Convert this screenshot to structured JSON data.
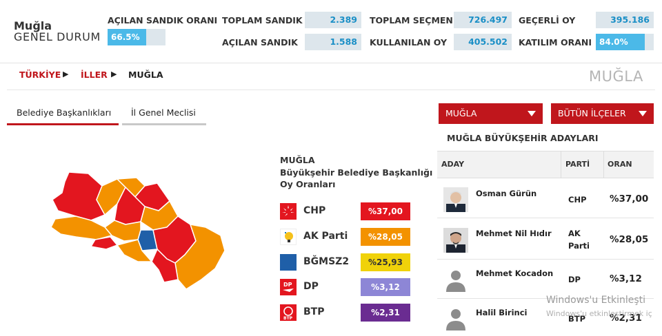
{
  "header": {
    "title_line1": "Muğla",
    "title_line2": "GENEL DURUM",
    "opened_ratio_label": "AÇILAN SANDIK ORANI",
    "opened_ratio_value": "66.5%",
    "opened_ratio_fraction": 0.665,
    "total_box_label": "TOPLAM SANDIK",
    "total_box_value": "2.389",
    "opened_box_label": "AÇILAN SANDIK",
    "opened_box_value": "1.588",
    "total_voters_label": "TOPLAM SEÇMEN",
    "total_voters_value": "726.497",
    "used_votes_label": "KULLANILAN OY",
    "used_votes_value": "405.502",
    "valid_votes_label": "GEÇERLİ OY",
    "valid_votes_value": "395.186",
    "turnout_label": "KATILIM ORANI",
    "turnout_value": "84.0%",
    "turnout_fraction": 0.84
  },
  "breadcrumb": {
    "items": [
      "TÜRKİYE",
      "İLLER",
      "MUĞLA"
    ],
    "city_title": "MUĞLA"
  },
  "tabs": {
    "active": "Belediye Başkanlıkları",
    "inactive": "İl Genel Meclisi"
  },
  "results": {
    "city": "MUĞLA",
    "subtitle_line1": "Büyükşehir Belediye Başkanlığı",
    "subtitle_line2": "Oy Oranları",
    "parties": [
      {
        "name": "CHP",
        "value": "%37,00",
        "color": "#e3161f",
        "logo": "chp-logo"
      },
      {
        "name": "AK Parti",
        "value": "%28,05",
        "color": "#f39200",
        "logo": "akp-logo"
      },
      {
        "name": "BĞMSZ2",
        "value": "%25,93",
        "color": "#f0d20a",
        "logo": "independent-logo"
      },
      {
        "name": "DP",
        "value": "%3,12",
        "color": "#8d86d6",
        "logo": "dp-logo"
      },
      {
        "name": "BTP",
        "value": "%2,31",
        "color": "#6a2c91",
        "logo": "btp-logo"
      }
    ]
  },
  "filters": {
    "province": "MUĞLA",
    "district": "BÜTÜN İLÇELER"
  },
  "candidates": {
    "title": "MUĞLA BÜYÜKŞEHİR ADAYLARI",
    "headers": {
      "candidate": "ADAY",
      "party": "PARTİ",
      "rate": "ORAN"
    },
    "rows": [
      {
        "name": "Osman Gürün",
        "party": "CHP",
        "rate": "%37,00",
        "avatar": "photo"
      },
      {
        "name": "Mehmet Nil Hıdır",
        "party": "AK Parti",
        "rate": "%28,05",
        "avatar": "photo"
      },
      {
        "name": "Mehmet Kocadon",
        "party": "DP",
        "rate": "%3,12",
        "avatar": "placeholder"
      },
      {
        "name": "Halil Birinci",
        "party": "BTP",
        "rate": "%2,31",
        "avatar": "placeholder"
      }
    ]
  },
  "watermark": {
    "line1": "Windows'u Etkinleşti",
    "line2": "Windows'u etkinleştirmek iç"
  }
}
